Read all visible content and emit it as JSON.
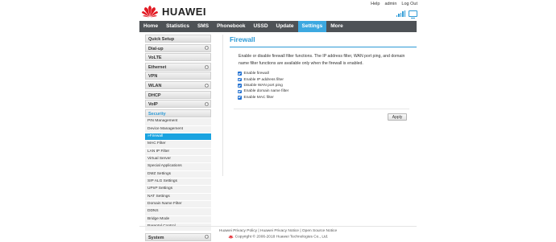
{
  "brand": {
    "name": "HUAWEI",
    "color": "#e21a23"
  },
  "top_links": [
    "Help",
    "admin",
    "Log Out"
  ],
  "nav": [
    "Home",
    "Statistics",
    "SMS",
    "Phonebook",
    "USSD",
    "Update",
    "Settings",
    "More"
  ],
  "nav_active": "Settings",
  "sidebar": {
    "top_items": [
      "Quick Setup",
      "Dial-up",
      "VoLTE",
      "Ethernet",
      "VPN",
      "WLAN",
      "DHCP",
      "VoIP"
    ],
    "open_group": "Security",
    "sub_items": [
      "PIN Management",
      "Device Management",
      "Firewall",
      "MAC Filter",
      "LAN IP Filter",
      "Virtual Server",
      "Special Applications",
      "DMZ Settings",
      "SIP ALG Settings",
      "UPnP Settings",
      "NAT Settings",
      "Domain Name Filter",
      "DDNS",
      "Bridge Mode",
      "Parental Control"
    ],
    "active_sub_label": "»Firewall",
    "bottom_item": "System"
  },
  "main": {
    "title": "Firewall",
    "description": "Enable or disable firewall filter functions. The IP address filter, WAN port ping, and domain name filter functions are available only when the firewall is enabled.",
    "options": [
      "Enable firewall",
      "Enable IP address filter",
      "Disable WAN port ping",
      "Enable domain name filter",
      "Enable MAC filter"
    ],
    "apply_label": "Apply"
  },
  "footer": {
    "privacy_policy": "Huawei Privacy Policy",
    "privacy_notice": "Huawei Privacy Notice",
    "open_source": "Open Source Notice",
    "sep": "|",
    "copyright": "Copyright © 2006-2018 Huawei Technologies Co., Ltd."
  },
  "colors": {
    "accent": "#3ca8e0",
    "nav_bg": "#4e5256",
    "checkbox": "#1f6fd1"
  }
}
